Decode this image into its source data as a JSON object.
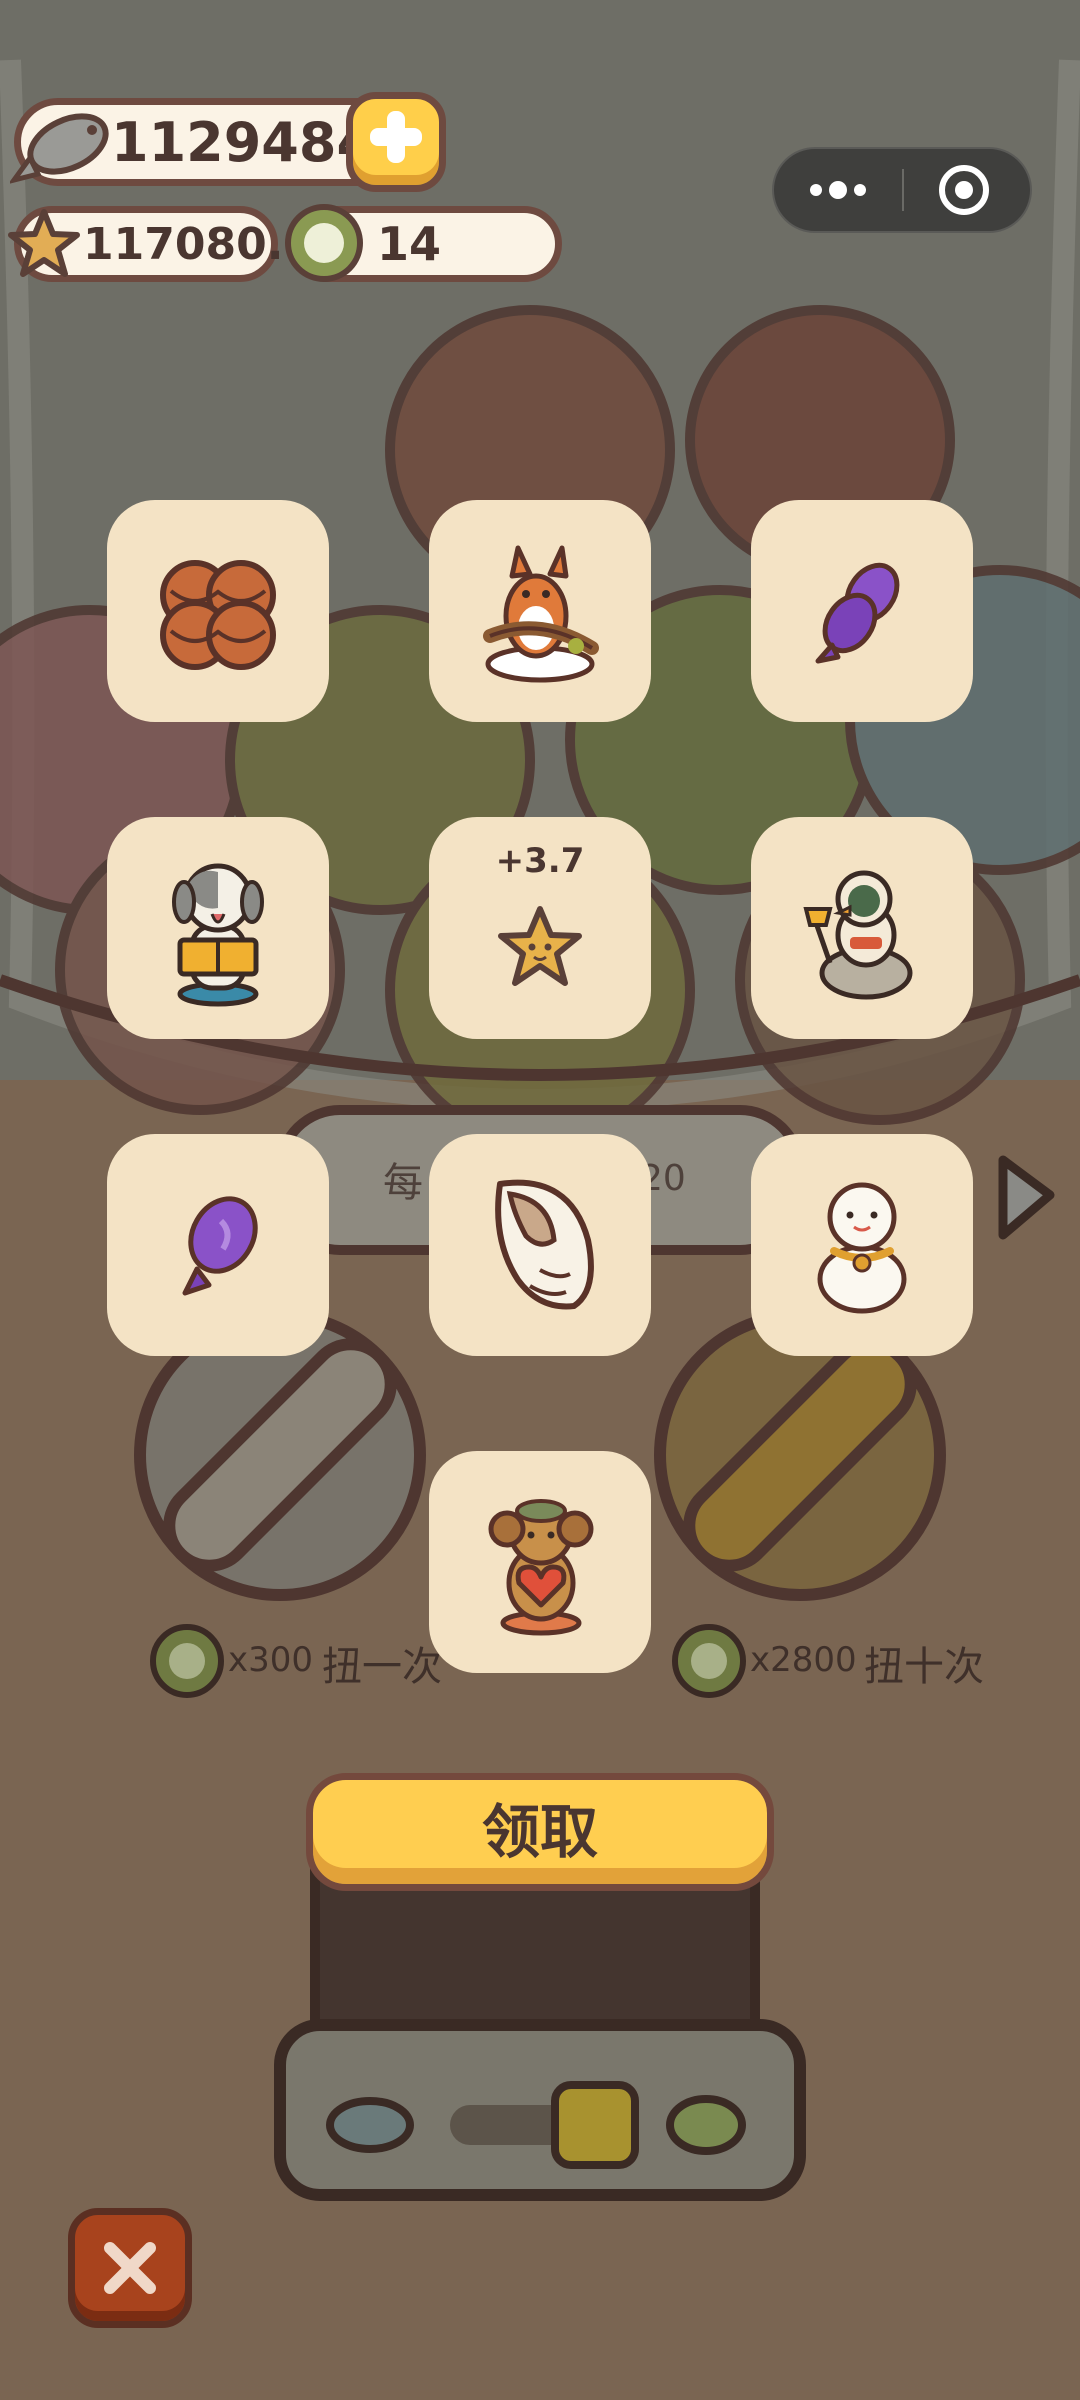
{
  "currencies": {
    "fish": "11294841",
    "stars": "117080.1",
    "tokens": "14"
  },
  "icons": {
    "fish": "fish-icon",
    "add": "plus-icon",
    "star": "star-icon",
    "token": "token-icon",
    "more": "more-dots-icon",
    "target": "target-icon",
    "next": "arrow-right-icon",
    "close": "close-icon"
  },
  "rewards": [
    {
      "item": "brown-yarn-balls"
    },
    {
      "item": "fox-figure"
    },
    {
      "item": "purple-fish"
    },
    {
      "item": "dog-reading-figure"
    },
    {
      "item": "star",
      "label": "+3.7"
    },
    {
      "item": "duck-explorer-figure"
    },
    {
      "item": "purple-fish-small"
    },
    {
      "item": "seashell"
    },
    {
      "item": "snowman-figure"
    },
    {
      "item": "bear-heart-figure"
    }
  ],
  "background": {
    "daily_left": "每",
    "daily_right": "20"
  },
  "gacha": {
    "single_cost": "x300",
    "single_label": "扭一次",
    "ten_cost": "x2800",
    "ten_label": "扭十次"
  },
  "claim_button": "领取",
  "colors": {
    "tile": "#f4e3c5",
    "button_yellow": "#ffce50",
    "outline": "#6e4a40",
    "close_red": "#a8431d"
  }
}
